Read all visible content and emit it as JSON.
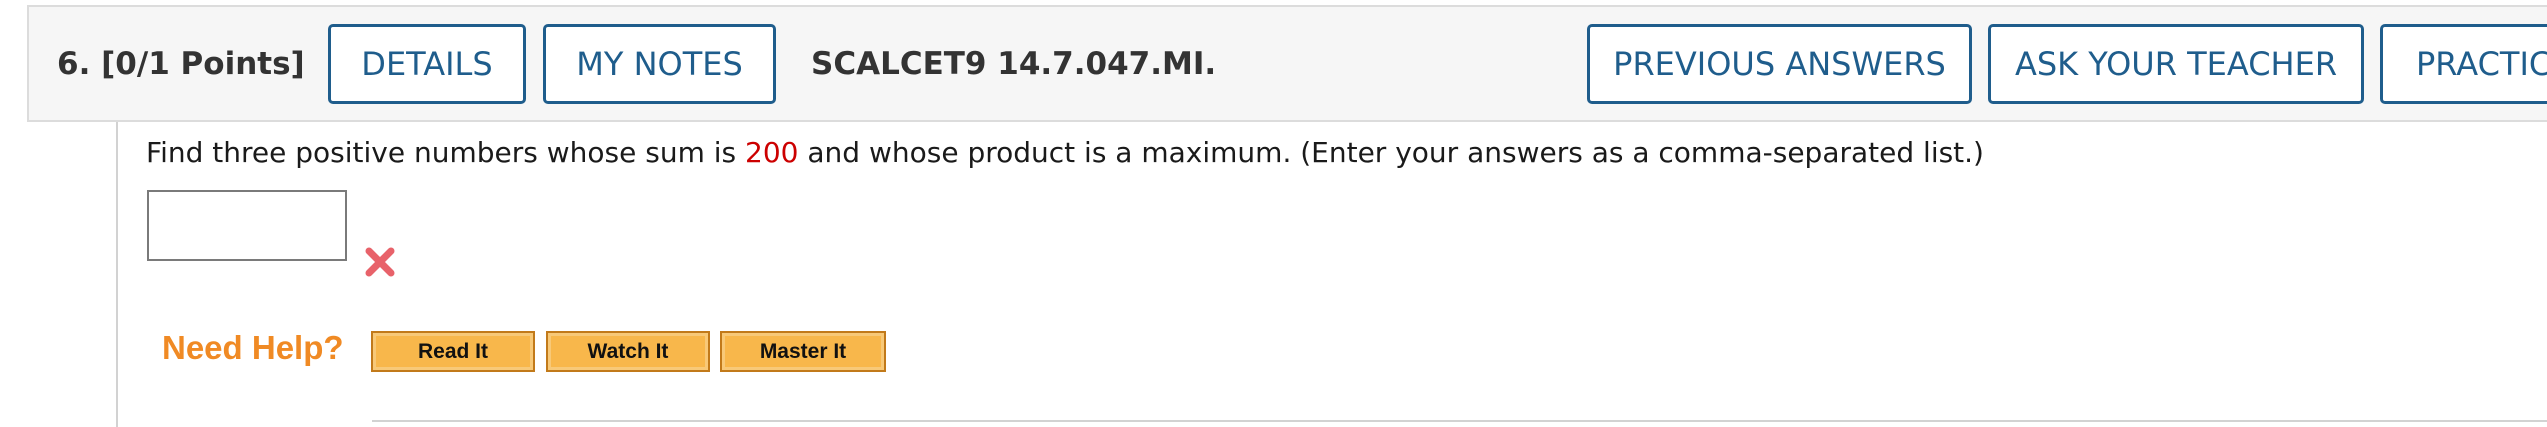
{
  "question": {
    "number_label": "6.  [0/1 Points]",
    "code": "SCALCET9 14.7.047.MI."
  },
  "header_buttons": {
    "details": "DETAILS",
    "my_notes": "MY NOTES",
    "previous_answers": "PREVIOUS ANSWERS",
    "ask_teacher": "ASK YOUR TEACHER",
    "practice": "PRACTICE ANOTHER"
  },
  "prompt": {
    "before": "Find three positive numbers whose sum is ",
    "highlight": "200",
    "after": " and whose product is a maximum. (Enter your answers as a comma-separated list.)"
  },
  "answer": {
    "value": "",
    "status_icon": "incorrect-x-icon"
  },
  "help": {
    "label": "Need Help?",
    "read_it": "Read It",
    "watch_it": "Watch It",
    "master_it": "Master It"
  },
  "colors": {
    "header_button_blue": "#1f5d8c",
    "highlight_red": "#cc0000",
    "incorrect_icon": "#e8626a",
    "need_help_orange": "#f08a24",
    "help_button_fill": "#f8b74b"
  }
}
